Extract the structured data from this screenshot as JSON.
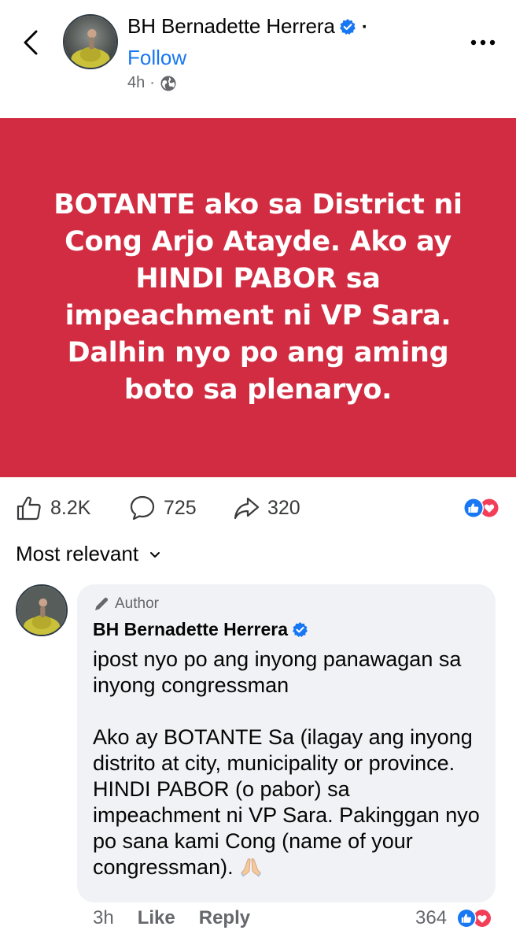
{
  "header": {
    "author_name": "BH Bernadette Herrera",
    "separator": "·",
    "follow_label": "Follow",
    "time": "4h",
    "time_separator": "·",
    "icons": [
      "back-icon",
      "verified-icon",
      "globe-icon",
      "more-icon"
    ]
  },
  "post": {
    "text": "BOTANTE ako sa District ni Cong Arjo Atayde. Ako ay HINDI PABOR sa impeachment ni VP Sara. Dalhin nyo po ang aming boto sa plenaryo.",
    "background_color": "#d12c41"
  },
  "actions": {
    "likes": "8.2K",
    "comments": "725",
    "shares": "320"
  },
  "sort": {
    "label": "Most relevant"
  },
  "comment": {
    "tag": "Author",
    "name": "BH Bernadette Herrera",
    "body": "ipost nyo po ang inyong panawagan sa inyong congressman\n\nAko ay BOTANTE Sa (ilagay ang inyong distrito at city, municipality or province. HINDI PABOR (o pabor) sa impeachment ni VP Sara. Pakinggan nyo po sana kami Cong (name of your congressman). ",
    "time": "3h",
    "like_label": "Like",
    "reply_label": "Reply",
    "reaction_count": "364"
  },
  "colors": {
    "accent": "#1877f2",
    "love": "#f33e58",
    "post_bg": "#d12c41"
  }
}
